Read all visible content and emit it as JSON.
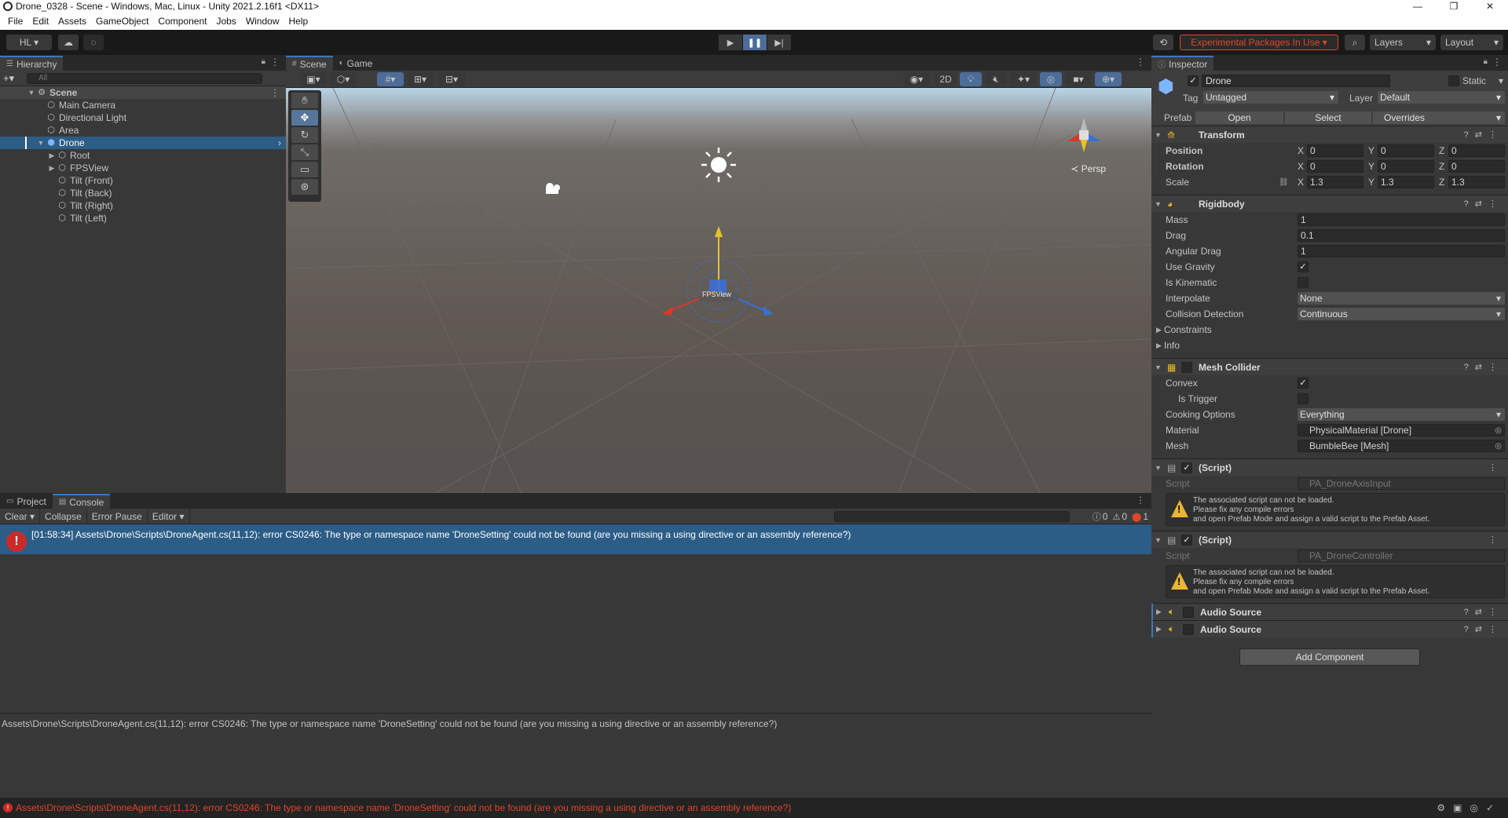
{
  "window": {
    "title": "Drone_0328 - Scene - Windows, Mac, Linux - Unity 2021.2.16f1 <DX11>",
    "minimize": "—",
    "maximize": "❐",
    "close": "✕"
  },
  "menu": [
    "File",
    "Edit",
    "Assets",
    "GameObject",
    "Component",
    "Jobs",
    "Window",
    "Help"
  ],
  "toolbar": {
    "account": "HL ▾",
    "experimental": "Experimental Packages In Use ▾",
    "layers": "Layers",
    "layout": "Layout"
  },
  "hierarchy": {
    "tab": "Hierarchy",
    "search_placeholder": "All",
    "items": [
      {
        "label": "Scene"
      },
      {
        "label": "Main Camera"
      },
      {
        "label": "Directional Light"
      },
      {
        "label": "Area"
      },
      {
        "label": "Drone"
      },
      {
        "label": "Root"
      },
      {
        "label": "FPSView"
      },
      {
        "label": "Tilt (Front)"
      },
      {
        "label": "Tilt (Back)"
      },
      {
        "label": "Tilt (Right)"
      },
      {
        "label": "Tilt (Left)"
      }
    ]
  },
  "scene": {
    "tabs": [
      "Scene",
      "Game"
    ],
    "mode_2d": "2D",
    "persp": "≺ Persp",
    "object_label": "FPSView"
  },
  "inspector": {
    "tab": "Inspector",
    "object_name": "Drone",
    "static_label": "Static",
    "tag_label": "Tag",
    "tag_value": "Untagged",
    "layer_label": "Layer",
    "layer_value": "Default",
    "prefab_label": "Prefab",
    "prefab_open": "Open",
    "prefab_select": "Select",
    "prefab_overrides": "Overrides",
    "transform": {
      "title": "Transform",
      "position_label": "Position",
      "position": [
        "0",
        "0",
        "0"
      ],
      "rotation_label": "Rotation",
      "rotation": [
        "0",
        "0",
        "0"
      ],
      "scale_label": "Scale",
      "scale": [
        "1.3",
        "1.3",
        "1.3"
      ]
    },
    "rigidbody": {
      "title": "Rigidbody",
      "mass_label": "Mass",
      "mass": "1",
      "drag_label": "Drag",
      "drag": "0.1",
      "angular_drag_label": "Angular Drag",
      "angular_drag": "1",
      "use_gravity_label": "Use Gravity",
      "is_kinematic_label": "Is Kinematic",
      "interpolate_label": "Interpolate",
      "interpolate": "None",
      "collision_label": "Collision Detection",
      "collision": "Continuous",
      "constraints_label": "Constraints",
      "info_label": "Info"
    },
    "mesh_collider": {
      "title": "Mesh Collider",
      "convex_label": "Convex",
      "is_trigger_label": "Is Trigger",
      "cooking_label": "Cooking Options",
      "cooking": "Everything",
      "material_label": "Material",
      "material": "PhysicalMaterial [Drone]",
      "mesh_label": "Mesh",
      "mesh": "BumbleBee [Mesh]"
    },
    "script1": {
      "title": "(Script)",
      "script_label": "Script",
      "script": "PA_DroneAxisInput",
      "warn1": "The associated script can not be loaded.",
      "warn2": "Please fix any compile errors",
      "warn3": "and open Prefab Mode and assign a valid script to the Prefab Asset."
    },
    "script2": {
      "title": "(Script)",
      "script_label": "Script",
      "script": "PA_DroneController",
      "warn1": "The associated script can not be loaded.",
      "warn2": "Please fix any compile errors",
      "warn3": "and open Prefab Mode and assign a valid script to the Prefab Asset."
    },
    "audio1": "Audio Source",
    "audio2": "Audio Source",
    "add_component": "Add Component"
  },
  "console": {
    "tabs": [
      "Project",
      "Console"
    ],
    "clear": "Clear",
    "collapse": "Collapse",
    "error_pause": "Error Pause",
    "editor": "Editor ▾",
    "count_info": "0",
    "count_warn": "0",
    "count_error": "1",
    "entry": "[01:58:34] Assets\\Drone\\Scripts\\DroneAgent.cs(11,12): error CS0246: The type or namespace name 'DroneSetting' could not be found (are you missing a using directive or an assembly reference?)",
    "detail": "Assets\\Drone\\Scripts\\DroneAgent.cs(11,12): error CS0246: The type or namespace name 'DroneSetting' could not be found (are you missing a using directive or an assembly reference?)"
  },
  "status": {
    "message": "Assets\\Drone\\Scripts\\DroneAgent.cs(11,12): error CS0246: The type or namespace name 'DroneSetting' could not be found (are you missing a using directive or an assembly reference?)"
  },
  "colors": {
    "selection": "#2c5d87",
    "error": "#e0462b",
    "accent": "#3a79bb"
  }
}
